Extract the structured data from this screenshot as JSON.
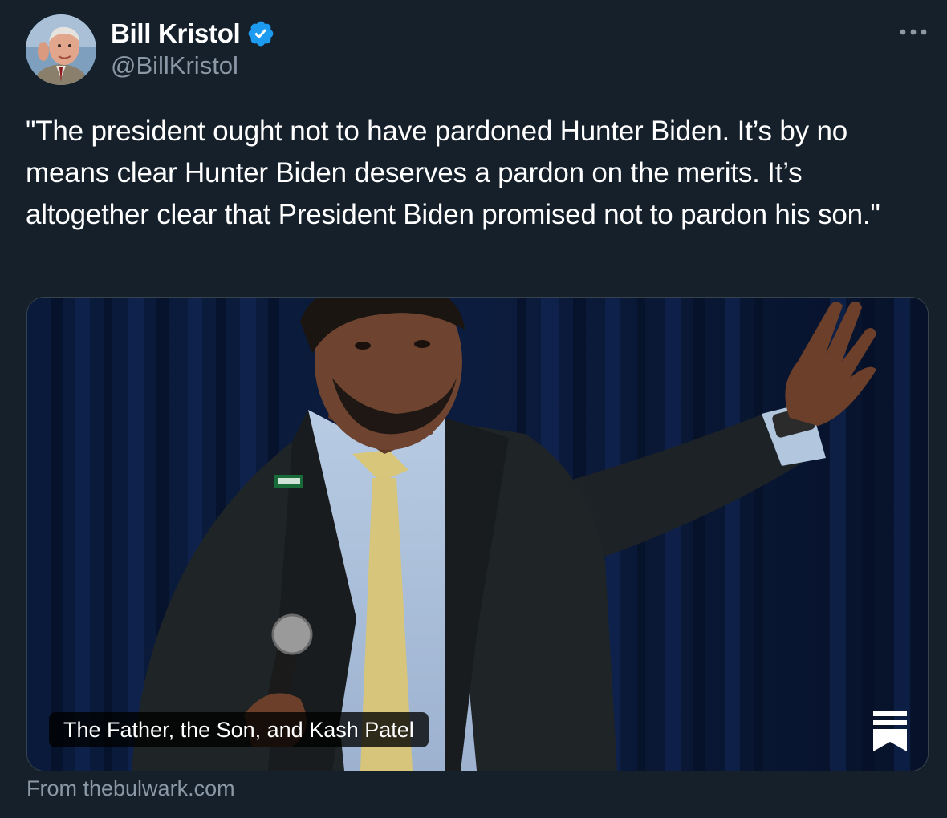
{
  "author": {
    "display_name": "Bill Kristol",
    "handle": "@BillKristol",
    "verified": true,
    "avatar_icon": "avatar-photo"
  },
  "tweet": {
    "text": "\"The president ought not to have pardoned Hunter Biden. It’s by no means clear Hunter Biden deserves a pardon on the merits. It’s altogether clear that President Biden promised not to pardon his son.\""
  },
  "link_card": {
    "title": "The Father, the Son, and Kash Patel",
    "source": "From thebulwark.com",
    "publisher_icon": "substack-bookmark-icon"
  },
  "icons": {
    "verified": "verified-badge-icon",
    "more": "more-options-icon"
  },
  "colors": {
    "background": "#15202b",
    "secondary_text": "#8b98a5",
    "verified_blue": "#1d9bf0",
    "card_border": "#38444d"
  }
}
